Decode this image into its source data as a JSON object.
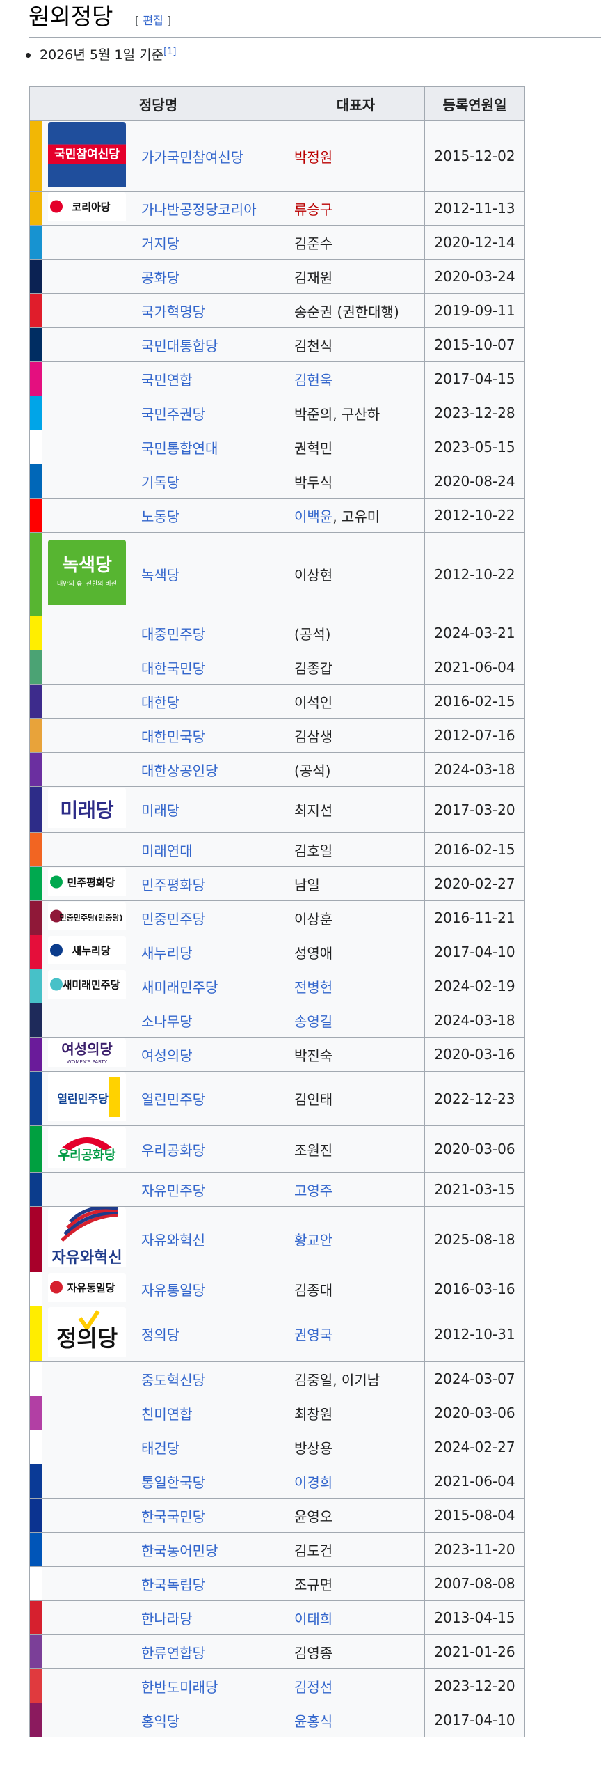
{
  "heading": {
    "title": "원외정당",
    "edit_open": "[ ",
    "edit_label": "편집",
    "edit_close": " ]"
  },
  "note": {
    "text": "2026년 5월 1일 기준",
    "ref": "[1]"
  },
  "table": {
    "headers": {
      "party": "정당명",
      "rep": "대표자",
      "date": "등록연원일"
    },
    "rows": [
      {
        "color": "#f2b705",
        "name": "가가국민참여신당",
        "rep": "박정원",
        "rep_link": true,
        "rep_red": true,
        "date": "2015-12-02",
        "logo": "국민참여신당"
      },
      {
        "color": "#f2b705",
        "name": "가나반공정당코리아",
        "rep": "류승구",
        "rep_link": true,
        "rep_red": true,
        "date": "2012-11-13",
        "logo": "코리아당"
      },
      {
        "color": "#1793d1",
        "name": "거지당",
        "rep": "김준수",
        "rep_link": false,
        "date": "2020-12-14"
      },
      {
        "color": "#0b2253",
        "name": "공화당",
        "rep": "김재원",
        "rep_link": false,
        "date": "2020-03-24"
      },
      {
        "color": "#e01d2b",
        "name": "국가혁명당",
        "rep": "송순권 (권한대행)",
        "rep_link": false,
        "date": "2019-09-11"
      },
      {
        "color": "#002d62",
        "name": "국민대통합당",
        "rep": "김천식",
        "rep_link": false,
        "date": "2015-10-07"
      },
      {
        "color": "#e40f7f",
        "name": "국민연합",
        "rep": "김현욱",
        "rep_link": true,
        "date": "2017-04-15"
      },
      {
        "color": "#00a5e8",
        "name": "국민주권당",
        "rep": "박준의, 구산하",
        "rep_link": false,
        "date": "2023-12-28"
      },
      {
        "color": "#ffffff",
        "name": "국민통합연대",
        "rep": "권혁민",
        "rep_link": false,
        "date": "2023-05-15"
      },
      {
        "color": "#0067b8",
        "name": "기독당",
        "rep": "박두식",
        "rep_link": false,
        "date": "2020-08-24"
      },
      {
        "color": "#ff0000",
        "name": "노동당",
        "rep": "이백윤",
        "rep_tail": ", 고유미",
        "rep_link": true,
        "date": "2012-10-22"
      },
      {
        "color": "#57b531",
        "name": "녹색당",
        "rep": "이상현",
        "rep_link": false,
        "date": "2012-10-22",
        "logo": "녹색당",
        "logo_sub": "대안의 숲, 전환의 비전"
      },
      {
        "color": "#ffee00",
        "name": "대중민주당",
        "rep": "(공석)",
        "rep_link": false,
        "date": "2024-03-21"
      },
      {
        "color": "#4ba374",
        "name": "대한국민당",
        "rep": "김종갑",
        "rep_link": false,
        "date": "2021-06-04"
      },
      {
        "color": "#3d2b8c",
        "name": "대한당",
        "rep": "이석인",
        "rep_link": false,
        "date": "2016-02-15"
      },
      {
        "color": "#e8a33a",
        "name": "대한민국당",
        "rep": "김삼생",
        "rep_link": false,
        "date": "2012-07-16"
      },
      {
        "color": "#6b2fa0",
        "name": "대한상공인당",
        "rep": "(공석)",
        "rep_link": false,
        "date": "2024-03-18"
      },
      {
        "color": "#2d2c88",
        "name": "미래당",
        "rep": "최지선",
        "rep_link": false,
        "date": "2017-03-20",
        "logo": "미래당"
      },
      {
        "color": "#f26522",
        "name": "미래연대",
        "rep": "김호일",
        "rep_link": false,
        "date": "2016-02-15"
      },
      {
        "color": "#00a94f",
        "name": "민주평화당",
        "rep": "남일",
        "rep_link": false,
        "date": "2020-02-27",
        "logo": "민주평화당"
      },
      {
        "color": "#8f1838",
        "name": "민중민주당",
        "rep": "이상훈",
        "rep_link": false,
        "date": "2016-11-21",
        "logo": "민중민주당(민중당)"
      },
      {
        "color": "#e50e3a",
        "name": "새누리당",
        "rep": "성영애",
        "rep_link": false,
        "date": "2017-04-10",
        "logo": "새누리당"
      },
      {
        "color": "#47c1c8",
        "name": "새미래민주당",
        "rep": "전병헌",
        "rep_link": true,
        "date": "2024-02-19",
        "logo": "새미래민주당"
      },
      {
        "color": "#1e2a5a",
        "name": "소나무당",
        "rep": "송영길",
        "rep_link": true,
        "date": "2024-03-18"
      },
      {
        "color": "#6a1b9a",
        "name": "여성의당",
        "rep": "박진숙",
        "rep_link": false,
        "date": "2020-03-16",
        "logo": "여성의당",
        "logo_sub": "WOMEN'S PARTY"
      },
      {
        "color": "#0e4194",
        "name": "열린민주당",
        "rep": "김인태",
        "rep_link": false,
        "date": "2022-12-23",
        "logo": "열린민주당"
      },
      {
        "color": "#00a040",
        "name": "우리공화당",
        "rep": "조원진",
        "rep_link": false,
        "date": "2020-03-06",
        "logo": "우리공화당"
      },
      {
        "color": "#0b3c8c",
        "name": "자유민주당",
        "rep": "고영주",
        "rep_link": true,
        "date": "2021-03-15"
      },
      {
        "color": "#a8002a",
        "name": "자유와혁신",
        "rep": "황교안",
        "rep_link": true,
        "date": "2025-08-18",
        "logo": "자유와혁신"
      },
      {
        "color": "#ffffff",
        "name": "자유통일당",
        "rep": "김종대",
        "rep_link": false,
        "date": "2016-03-16",
        "logo": "자유통일당"
      },
      {
        "color": "#ffed00",
        "name": "정의당",
        "rep": "권영국",
        "rep_link": true,
        "date": "2012-10-31",
        "logo": "정의당"
      },
      {
        "color": "#ffffff",
        "name": "중도혁신당",
        "rep": "김중일, 이기남",
        "rep_link": false,
        "date": "2024-03-07"
      },
      {
        "color": "#b23fa4",
        "name": "친미연합",
        "rep": "최창원",
        "rep_link": false,
        "date": "2020-03-06"
      },
      {
        "color": "#ffffff",
        "name": "태건당",
        "rep": "방상용",
        "rep_link": false,
        "date": "2024-02-27"
      },
      {
        "color": "#0a3a96",
        "name": "통일한국당",
        "rep": "이경희",
        "rep_link": true,
        "date": "2021-06-04"
      },
      {
        "color": "#0b3390",
        "name": "한국국민당",
        "rep": "윤영오",
        "rep_link": false,
        "date": "2015-08-04"
      },
      {
        "color": "#0055b8",
        "name": "한국농어민당",
        "rep": "김도건",
        "rep_link": false,
        "date": "2023-11-20"
      },
      {
        "color": "#ffffff",
        "name": "한국독립당",
        "rep": "조규면",
        "rep_link": false,
        "date": "2007-08-08"
      },
      {
        "color": "#d6202e",
        "name": "한나라당",
        "rep": "이태희",
        "rep_link": true,
        "date": "2013-04-15"
      },
      {
        "color": "#7b3f98",
        "name": "한류연합당",
        "rep": "김영종",
        "rep_link": false,
        "date": "2021-01-26"
      },
      {
        "color": "#e03a3e",
        "name": "한반도미래당",
        "rep": "김정선",
        "rep_link": true,
        "date": "2023-12-20"
      },
      {
        "color": "#8b1a5e",
        "name": "홍익당",
        "rep": "윤홍식",
        "rep_link": true,
        "date": "2017-04-10"
      }
    ]
  }
}
